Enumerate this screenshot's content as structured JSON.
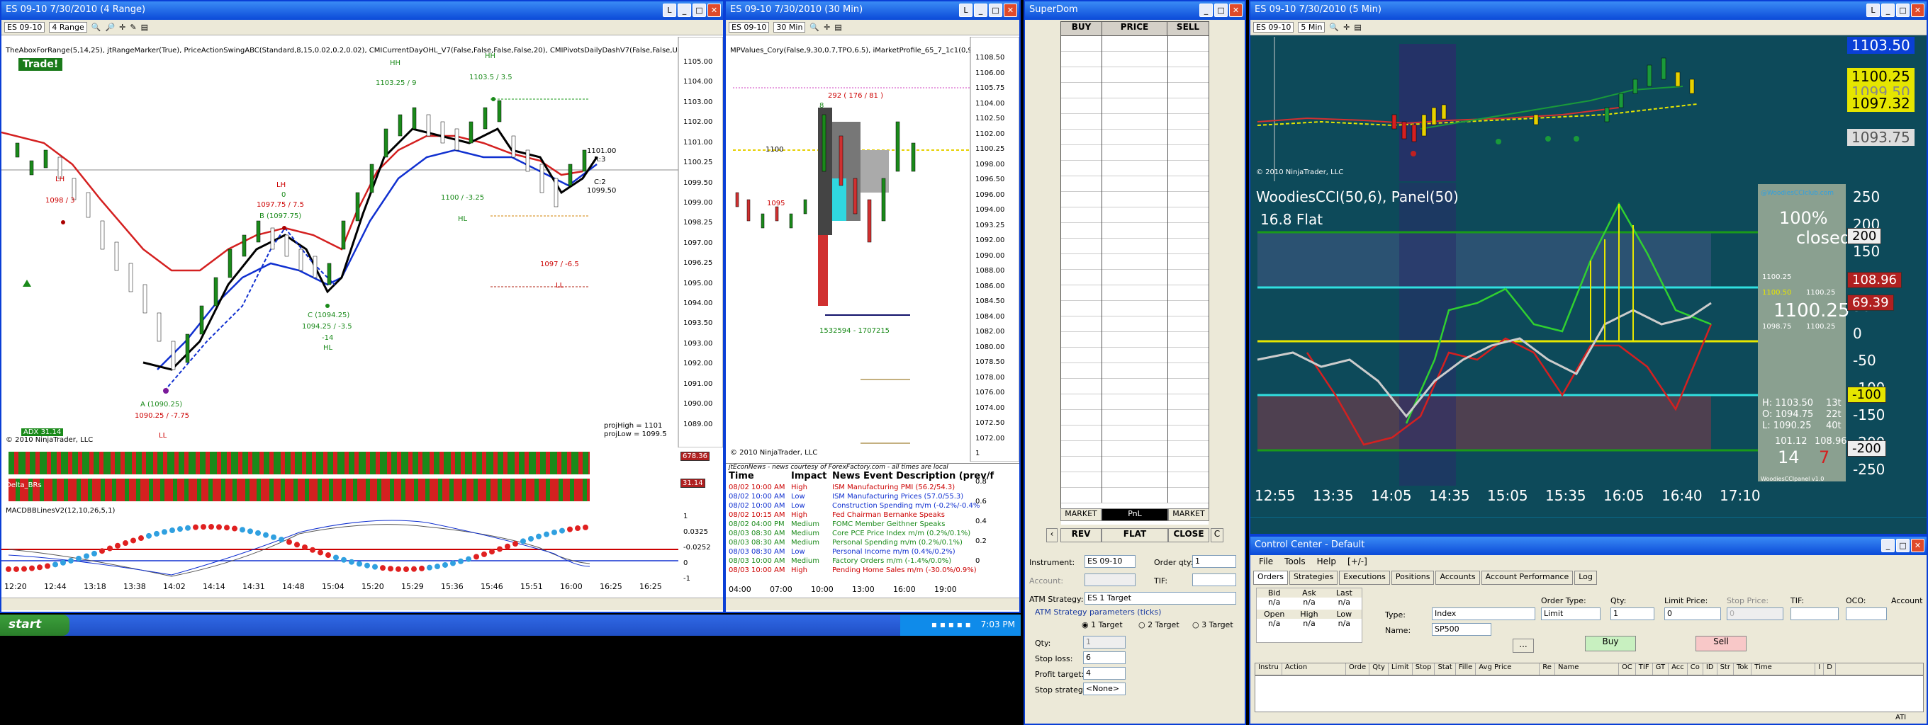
{
  "w1": {
    "title": "ES 09-10  7/30/2010 (4 Range)",
    "instrument": "ES 09-10",
    "interval": "4 Range",
    "indicators": "TheAboxForRange(5,14,25), jtRangeMarker(True), PriceActionSwingABC(Standard,8,15,0.02,0.2,0.02), CMICurrentDayOHL_V7(False,False,False,False,20), CMIPivotsDailyDashV7(False,False,UserDefinedVa",
    "trade_label": "Trade!",
    "copyright": "© 2010 NinjaTrader, LLC",
    "adx": "ADX 31.14",
    "proj_high": "projHigh = 1101",
    "proj_low": "projLow = 1099.5",
    "macd": "MACDBBLinesV2(12,10,26,5,1)",
    "lh1": "LH",
    "lh1_val": "1098 / 3",
    "lh2": "LH",
    "lh2_cnt": "0",
    "lh2_val": "1097.75 / 7.5",
    "b_lbl": "B (1097.75)",
    "hh1": "HH",
    "hh1_val": "1103.25 / 9",
    "hh2": "HH",
    "hh2_val": "1103.5 / 3.5",
    "low_a": "A (1090.25)",
    "low_a_val": "1090.25 / -7.75",
    "ll": "LL",
    "c_lbl": "C (1094.25)",
    "c_val": "1094.25 / -3.5",
    "c_cnt": "-14",
    "hl1": "HL",
    "hl2": "HL",
    "v1100": "1100 / -3.25",
    "v1097": "1097 / -6.5",
    "ll2": "LL",
    "r3": "R:3",
    "c2": "C:2",
    "p1101": "1101.00",
    "p1099": "1099.50",
    "osc1": "678.36",
    "osc2": "31.14",
    "osc_lbl": "Delta_BRs",
    "prices": [
      "1105.00",
      "1104.00",
      "1103.00",
      "1102.00",
      "1101.00",
      "1100.25",
      "1099.50",
      "1099.00",
      "1098.25",
      "1097.00",
      "1096.25",
      "1095.00",
      "1094.00",
      "1093.50",
      "1093.00",
      "1092.00",
      "1091.00",
      "1090.00",
      "1089.00"
    ],
    "times": [
      "12:20",
      "12:44",
      "13:18",
      "13:38",
      "14:02",
      "14:14",
      "14:31",
      "14:48",
      "15:04",
      "15:20",
      "15:29",
      "15:36",
      "15:46",
      "15:51",
      "16:00",
      "16:25",
      "16:25"
    ],
    "macd_axis": [
      "1",
      "0.0325",
      "-0.0252",
      "0",
      "-1"
    ]
  },
  "w2": {
    "title": "ES 09-10  7/30/2010 (30 Min)",
    "instrument": "ES 09-10",
    "interval": "30 Min",
    "indicators": "MPValues_Cory(False,9,30,0.7,TPO,6.5), iMarketProfile_65_7_1c1(0,9,30,True,6",
    "poc": "292 ( 176 / 81 )",
    "p1100": "1100",
    "p1095": "1095",
    "p_r": "8",
    "vol": "1532594 - 1707215",
    "copyright": "© 2010 NinjaTrader, LLC",
    "prices": [
      "1108.50",
      "1106.00",
      "1105.75",
      "1104.00",
      "1102.50",
      "1102.00",
      "1100.25",
      "1098.00",
      "1096.50",
      "1096.00",
      "1094.00",
      "1093.25",
      "1092.00",
      "1090.00",
      "1088.00",
      "1086.00",
      "1084.50",
      "1084.00",
      "1082.00",
      "1080.00",
      "1078.50",
      "1078.00",
      "1076.00",
      "1074.00",
      "1072.50",
      "1072.00",
      "1"
    ],
    "osc_axis": [
      "0.8",
      "0.6",
      "0.4",
      "0.2",
      "0"
    ],
    "times": [
      "04:00",
      "07:00",
      "10:00",
      "13:00",
      "16:00",
      "19:00"
    ],
    "news_title": "jtEconNews - news courtesy of ForexFactory.com - all times are local",
    "news_hdr": [
      "Time",
      "Impact",
      "News Event Description (prev/f"
    ],
    "news": [
      [
        "08/02 10:00 AM",
        "High",
        "ISM Manufacturing PMI (56.2/54.3)"
      ],
      [
        "08/02 10:00 AM",
        "Low",
        "ISM Manufacturing Prices (57.0/55.3)"
      ],
      [
        "08/02 10:00 AM",
        "Low",
        "Construction Spending m/m (-0.2%/-0.4%"
      ],
      [
        "08/02 10:15 AM",
        "High",
        "Fed Chairman Bernanke Speaks"
      ],
      [
        "08/02 04:00 PM",
        "Medium",
        "FOMC Member Geithner Speaks"
      ],
      [
        "08/03 08:30 AM",
        "Medium",
        "Core PCE Price Index m/m (0.2%/0.1%)"
      ],
      [
        "08/03 08:30 AM",
        "Medium",
        "Personal Spending m/m (0.2%/0.1%)"
      ],
      [
        "08/03 08:30 AM",
        "Low",
        "Personal Income m/m (0.4%/0.2%)"
      ],
      [
        "08/03 10:00 AM",
        "Medium",
        "Factory Orders m/m (-1.4%/0.0%)"
      ],
      [
        "08/03 10:00 AM",
        "High",
        "Pending Home Sales m/m (-30.0%/0.9%)"
      ]
    ]
  },
  "taskbar": {
    "start": "start",
    "time": "7:03 PM"
  },
  "superdom": {
    "title": "SuperDom",
    "hdr": [
      "BUY",
      "PRICE",
      "SELL"
    ],
    "market1": "MARKET",
    "pnl": "PnL",
    "market2": "MARKET",
    "rev": "REV",
    "flat": "FLAT",
    "close": "CLOSE",
    "c_btn": "C",
    "instrument_lbl": "Instrument:",
    "instrument": "ES 09-10",
    "orderqty_lbl": "Order qty:",
    "orderqty": "1",
    "account_lbl": "Account:",
    "tif_lbl": "TIF:",
    "atm_lbl": "ATM Strategy:",
    "atm": "ES 1 Target",
    "atm_params": "ATM Strategy parameters (ticks)",
    "t1": "1 Target",
    "t2": "2 Target",
    "t3": "3 Target",
    "qty_lbl": "Qty:",
    "qty": "1",
    "stop_lbl": "Stop loss:",
    "stop": "6",
    "profit_lbl": "Profit target:",
    "profit": "4",
    "stopstr_lbl": "Stop strategy:",
    "stopstr": "<None>"
  },
  "w4": {
    "title": "ES 09-10  7/30/2010 (5 Min)",
    "instrument": "ES 09-10",
    "interval": "5 Min",
    "copyright": "© 2010 NinjaTrader, LLC",
    "cci": "WoodiesCCI(50,6), Panel(50)",
    "flat": "16.8 Flat",
    "pct": "100%",
    "closed": "closed",
    "brand": "@WoodiesCCIclub.com",
    "v1": "1100.25",
    "v2": "1100.50",
    "v3": "1100.25",
    "big": "1100.25",
    "v4": "1098.75",
    "v5": "1100.25",
    "h": "H: 1103.50",
    "o": "O: 1094.75",
    "l": "L: 1090.25",
    "h_r": "13t",
    "o_r": "22t",
    "l_r": "40t",
    "a1": "101.12",
    "a2": "108.96",
    "n1": "14",
    "n2": "7",
    "foot": "WoodiesCCIpanel v1.0",
    "p_top": "1103.50",
    "p2": "1100.25",
    "p3": "1099.50",
    "p4": "1097.32",
    "p5": "1093.75",
    "cci_axis": [
      "250",
      "200",
      "150",
      "100",
      "50",
      "0",
      "-50",
      "-100",
      "-150",
      "-200",
      "-250"
    ],
    "tag_200": "200",
    "tag_108": "108.96",
    "tag_69": "69.39",
    "tag_m100": "-100",
    "tag_m200": "-200",
    "times": [
      "12:55",
      "13:35",
      "14:05",
      "14:35",
      "15:05",
      "15:35",
      "16:05",
      "16:40",
      "17:10"
    ]
  },
  "cc": {
    "title": "Control Center - Default",
    "menu": [
      "File",
      "Tools",
      "Help",
      "[+/-]"
    ],
    "tabs": [
      "Orders",
      "Strategies",
      "Executions",
      "Positions",
      "Accounts",
      "Account Performance",
      "Log"
    ],
    "q_hdr": [
      "Bid",
      "Ask",
      "Last"
    ],
    "q_row": [
      "n/a",
      "n/a",
      "n/a"
    ],
    "q_hdr2": [
      "Open",
      "High",
      "Low"
    ],
    "q_row2": [
      "n/a",
      "n/a",
      "n/a"
    ],
    "type_lbl": "Type:",
    "type": "Index",
    "name_lbl": "Name:",
    "name": "SP500",
    "ordertype_lbl": "Order Type:",
    "ordertype": "Limit",
    "qty_lbl": "Qty:",
    "qty": "1",
    "limit_lbl": "Limit Price:",
    "limit": "0",
    "stop_lbl": "Stop Price:",
    "stop": "0",
    "tif_lbl": "TIF:",
    "oco_lbl": "OCO:",
    "account_lbl": "Account",
    "more": "...",
    "buy": "Buy",
    "sell": "Sell",
    "cols": [
      "Instru",
      "Action",
      "Orde",
      "Qty",
      "Limit",
      "Stop",
      "Stat",
      "Fille",
      "Avg Price",
      "Re",
      "Name",
      "OC",
      "TIF",
      "GT",
      "Acc",
      "Co",
      "ID",
      "Str",
      "Tok",
      "Time",
      "I",
      "D"
    ],
    "status": "ATI"
  }
}
